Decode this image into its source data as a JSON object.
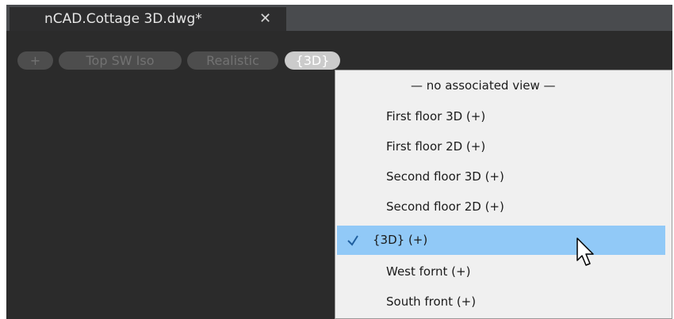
{
  "document_tab": {
    "title": "nCAD.Cottage 3D.dwg*",
    "close_glyph": "✕"
  },
  "viewport_controls": {
    "plus_label": "+",
    "view_label": "Top SW Iso",
    "style_label": "Realistic",
    "named_view_label": "{3D}"
  },
  "view_menu": {
    "items": [
      {
        "label": "— no associated view —",
        "selected": false
      },
      {
        "label": "First floor 3D (+)",
        "selected": false
      },
      {
        "label": "First floor 2D (+)",
        "selected": false
      },
      {
        "label": "Second floor 3D (+)",
        "selected": false
      },
      {
        "label": "Second floor 2D (+)",
        "selected": false
      },
      {
        "label": "{3D} (+)",
        "selected": true
      },
      {
        "label": "West fornt (+)",
        "selected": false
      },
      {
        "label": "South front (+)",
        "selected": false
      }
    ]
  },
  "colors": {
    "canvas_background": "#2b2b2b",
    "menu_background": "#f0f0f0",
    "selected_highlight": "#91c9f7",
    "check_mark": "#1f5f9f"
  },
  "icons": {
    "check": "check-icon",
    "cursor": "mouse-pointer-icon",
    "close": "close-icon"
  }
}
